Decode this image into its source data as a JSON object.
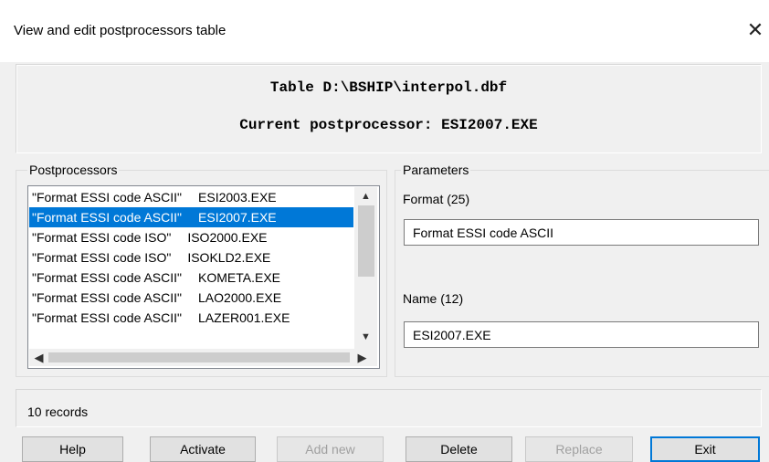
{
  "window": {
    "title": "View and edit postprocessors table",
    "close_glyph": "✕"
  },
  "header": {
    "table_line": "Table D:\\BSHIP\\interpol.dbf",
    "current_line": "Current postprocessor: ESI2007.EXE"
  },
  "postprocessors": {
    "group_label": "Postprocessors",
    "items": [
      {
        "format": "\"Format ESSI code ASCII\"",
        "name": "ESI2003.EXE",
        "selected": false
      },
      {
        "format": "\"Format ESSI code ASCII\"",
        "name": "ESI2007.EXE",
        "selected": true
      },
      {
        "format": "\"Format ESSI code ISO\"",
        "name": "ISO2000.EXE",
        "selected": false
      },
      {
        "format": "\"Format ESSI code ISO\"",
        "name": "ISOKLD2.EXE",
        "selected": false
      },
      {
        "format": "\"Format ESSI code ASCII\"",
        "name": "KOMETA.EXE",
        "selected": false
      },
      {
        "format": "\"Format ESSI code ASCII\"",
        "name": "LAO2000.EXE",
        "selected": false
      },
      {
        "format": "\"Format ESSI code ASCII\"",
        "name": "LAZER001.EXE",
        "selected": false
      }
    ]
  },
  "parameters": {
    "group_label": "Parameters",
    "format_label": "Format (25)",
    "format_value": "Format ESSI code ASCII",
    "name_label": "Name (12)",
    "name_value": "ESI2007.EXE"
  },
  "status": {
    "records": "10 records"
  },
  "buttons": {
    "help": "Help",
    "activate": "Activate",
    "add_new": "Add new",
    "delete": "Delete",
    "replace": "Replace",
    "exit": "Exit"
  },
  "colors": {
    "selection": "#0078d7",
    "background": "#f0f0f0"
  }
}
